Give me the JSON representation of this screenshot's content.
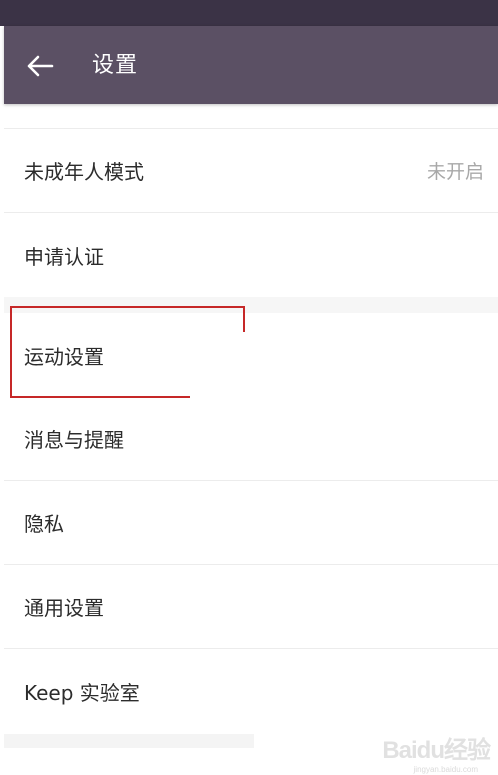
{
  "header": {
    "title": "设置"
  },
  "settings": {
    "items": [
      {
        "label": "未成年人模式",
        "value": "未开启"
      },
      {
        "label": "申请认证"
      },
      {
        "label": "运动设置"
      },
      {
        "label": "消息与提醒"
      },
      {
        "label": "隐私"
      },
      {
        "label": "通用设置"
      },
      {
        "label": "Keep 实验室"
      }
    ]
  },
  "watermark": {
    "brand": "Baidu经验",
    "url": "jingyan.baidu.com"
  },
  "colors": {
    "status_bar": "#3b3346",
    "app_bar": "#5b5064",
    "highlight": "#c62828"
  }
}
